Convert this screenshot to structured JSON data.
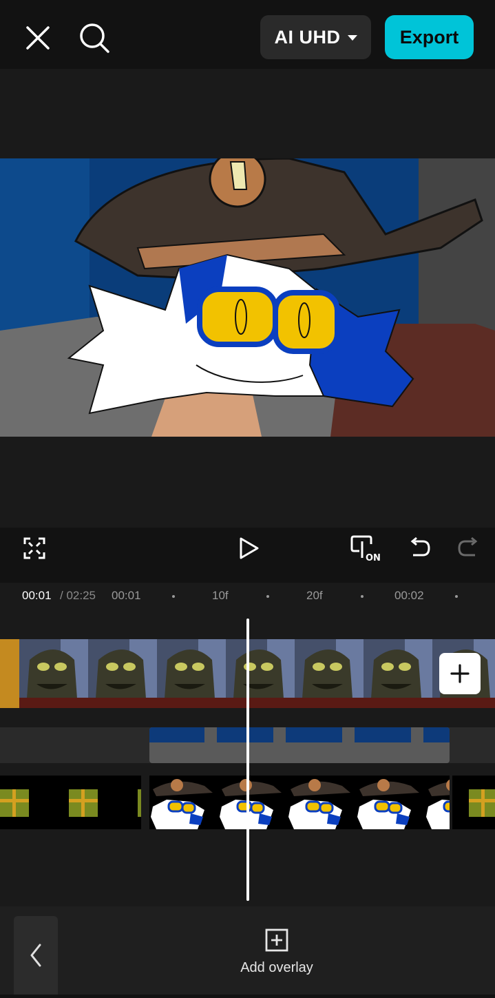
{
  "toolbar": {
    "quality_label": "AI UHD",
    "export_label": "Export"
  },
  "timeline": {
    "current_time": "00:01",
    "total_time": "/ 02:25",
    "ruler_labels": [
      "00:01",
      "10f",
      "20f",
      "00:02"
    ]
  },
  "bottom": {
    "add_overlay_label": "Add overlay"
  },
  "colors": {
    "accent": "#00c4d8",
    "background": "#121212",
    "panel": "#1a1a1a"
  },
  "icons": [
    "close-icon",
    "search-icon",
    "fullscreen-icon",
    "play-icon",
    "keyframe-on-icon",
    "undo-icon",
    "redo-icon",
    "plus-icon",
    "chevron-left-icon",
    "add-overlay-icon"
  ]
}
